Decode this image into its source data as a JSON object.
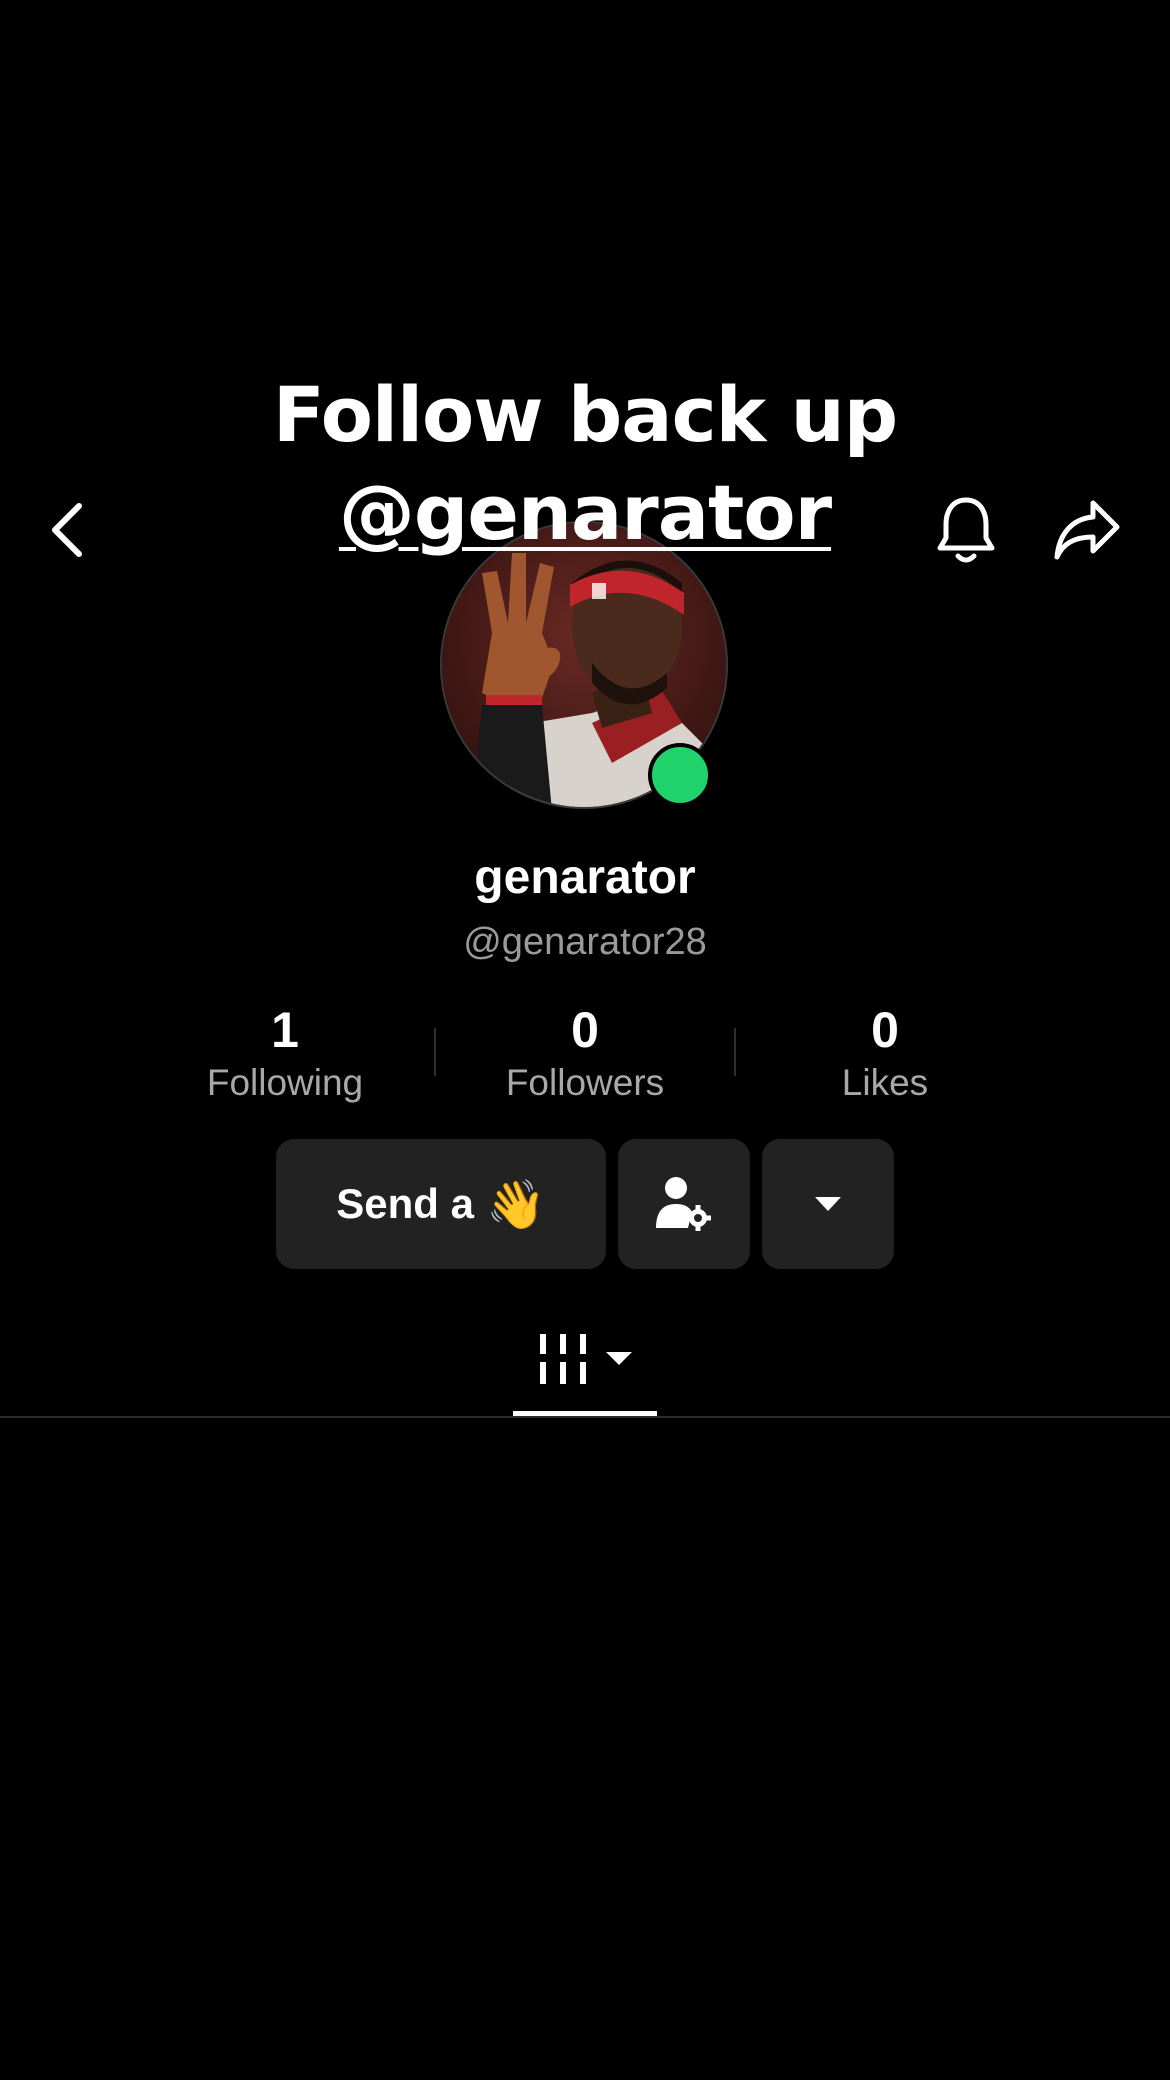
{
  "overlay": {
    "line1": "Follow back up",
    "line2": "@genarator"
  },
  "header": {
    "back_icon": "chevron-left-icon",
    "bell_icon": "bell-icon",
    "share_icon": "share-arrow-icon"
  },
  "profile": {
    "display_name": "genarator",
    "username": "@genarator28",
    "online": true,
    "online_color": "#20d26b"
  },
  "stats": [
    {
      "value": "1",
      "label": "Following"
    },
    {
      "value": "0",
      "label": "Followers"
    },
    {
      "value": "0",
      "label": "Likes"
    }
  ],
  "actions": {
    "wave_label": "Send a",
    "wave_emoji": "👋",
    "person_settings_icon": "person-gear-icon",
    "more_icon": "caret-down-icon"
  },
  "tabs": {
    "active_icon": "grid-columns-icon",
    "dropdown_icon": "caret-down-icon"
  },
  "colors": {
    "background": "#000000",
    "button_bg": "#222222",
    "secondary_text": "#a8a8a8"
  }
}
